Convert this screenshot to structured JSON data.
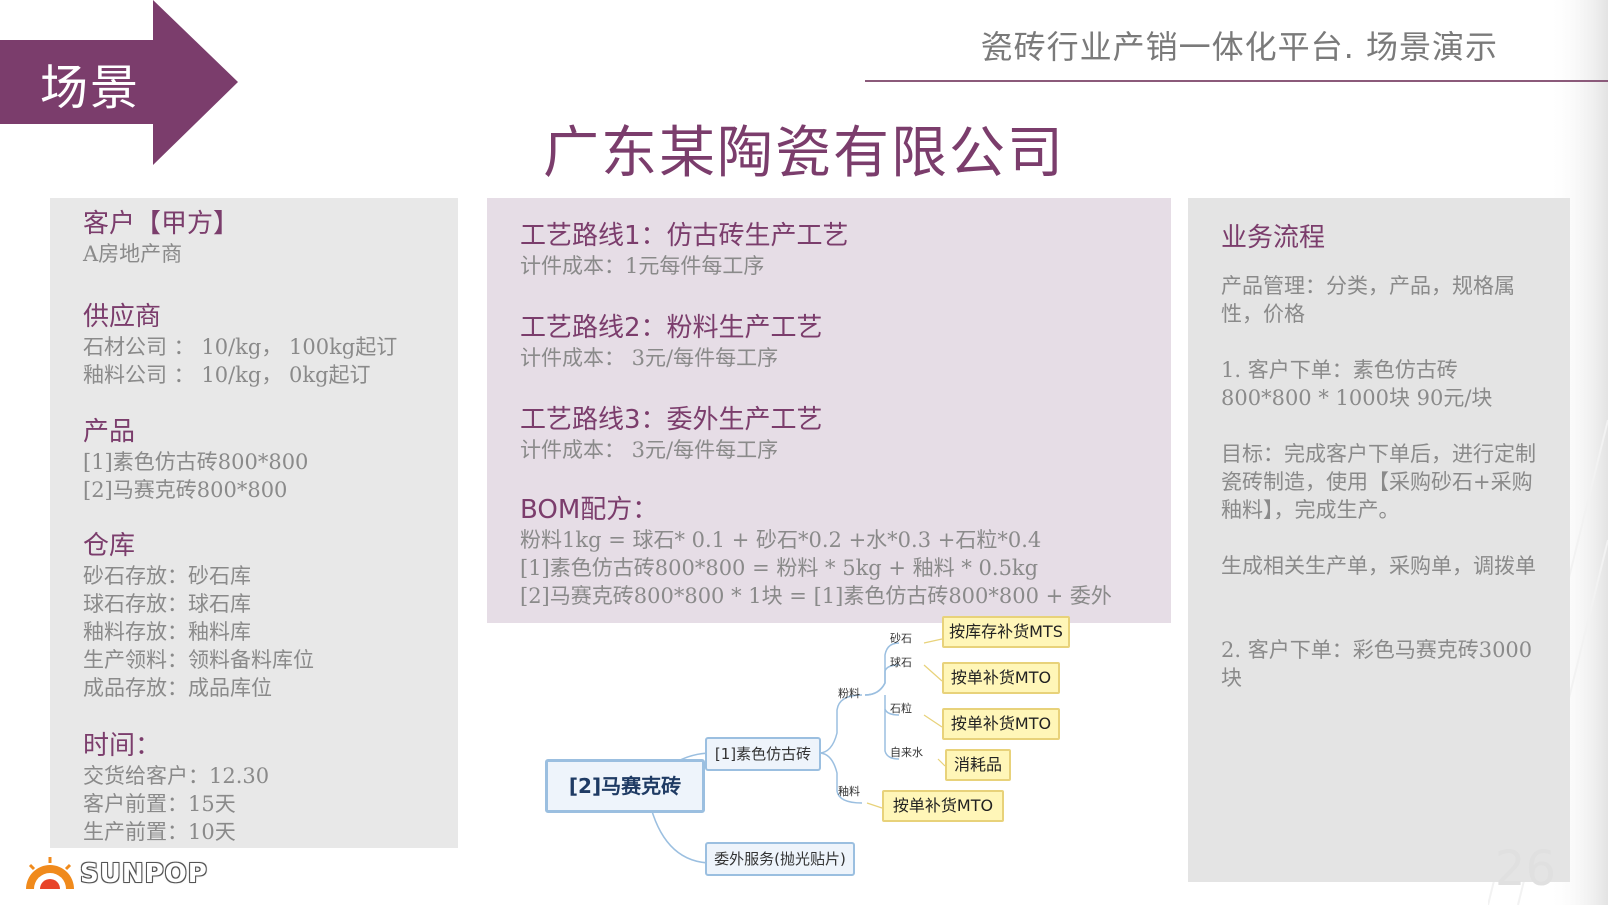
{
  "header": {
    "scene_label": "场景",
    "deck_title": "瓷砖行业产销一体化平台. 场景演示",
    "company_title": "广东某陶瓷有限公司",
    "accent": "#7b3d6c"
  },
  "left_panel": {
    "customer_heading": "客户【甲方】",
    "customer_lines": [
      "A房地产商"
    ],
    "supplier_heading": "供应商",
    "supplier_lines": [
      "石材公司 ： 10/kg， 100kg起订",
      "釉料公司 ： 10/kg，    0kg起订"
    ],
    "product_heading": "产品",
    "product_lines": [
      "[1]素色仿古砖800*800",
      "[2]马赛克砖800*800"
    ],
    "warehouse_heading": "仓库",
    "warehouse_lines": [
      "砂石存放：砂石库",
      "球石存放：球石库",
      "釉料存放：釉料库",
      "生产领料：领料备料库位",
      "成品存放：成品库位"
    ],
    "time_heading": "时间：",
    "time_lines": [
      "交货给客户：12.30",
      "客户前置：15天",
      "生产前置：10天"
    ]
  },
  "mid_panel": {
    "route1_title": "工艺路线1：仿古砖生产工艺",
    "route1_cost": "计件成本：1元每件每工序",
    "route2_title": "工艺路线2：粉料生产工艺",
    "route2_cost": "计件成本：  3元/每件每工序",
    "route3_title": "工艺路线3：委外生产工艺",
    "route3_cost": "计件成本：  3元/每件每工序",
    "bom_heading": "BOM配方：",
    "bom_lines": [
      "粉料1kg  =  球石* 0.1  +  砂石*0.2  +水*0.3  +石粒*0.4",
      "[1]素色仿古砖800*800  =  粉料  *  5kg  +  釉料  *  0.5kg",
      "[2]马赛克砖800*800  *  1块  =  [1]素色仿古砖800*800  +  委外"
    ]
  },
  "right_panel": {
    "heading": "业务流程",
    "p1": "产品管理：分类，产品，规格属性，价格",
    "p2a": "1. 客户下单：素色仿古砖",
    "p2b": "800*800  *  1000块  90元/块",
    "p3": "目标：完成客户下单后，进行定制瓷砖制造，使用【采购砂石+采购釉料】，完成生产。",
    "p4": "生成相关生产单，采购单，调拨单",
    "p5": "2. 客户下单：彩色马赛克砖3000块"
  },
  "diagram": {
    "root": "[2]马赛克砖",
    "child1": "[1]素色仿古砖",
    "child2": "委外服务(抛光贴片)",
    "branch_powder": "粉料",
    "branch_glaze": "釉料",
    "leaf_sand": "砂石",
    "leaf_ball": "球石",
    "leaf_grain": "石粒",
    "leaf_water": "自来水",
    "tag_sand": "按库存补货MTS",
    "tag_ball": "按单补货MTO",
    "tag_grain": "按单补货MTO",
    "tag_water": "消耗品",
    "tag_glaze": "按单补货MTO"
  },
  "footer": {
    "brand": "SUNPOP",
    "page_number": "26"
  }
}
